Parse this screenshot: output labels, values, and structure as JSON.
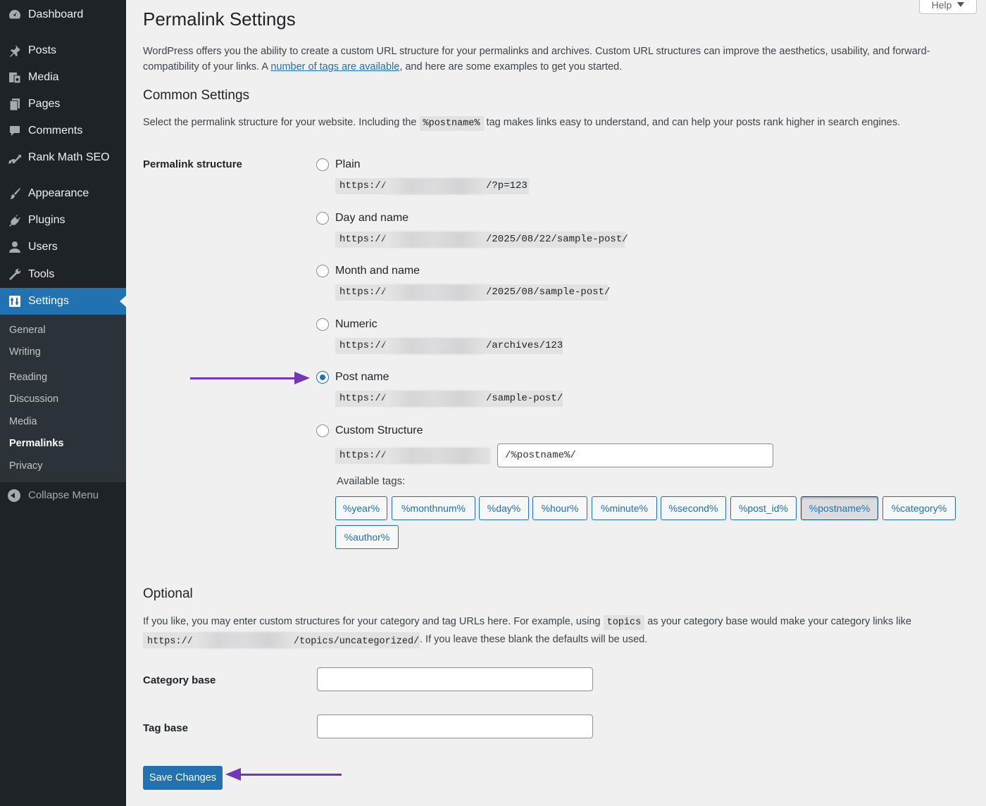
{
  "sidebar": {
    "menu": [
      {
        "label": "Dashboard",
        "icon": "dashboard-icon"
      },
      {
        "label": "Posts",
        "icon": "pin-icon"
      },
      {
        "label": "Media",
        "icon": "media-icon"
      },
      {
        "label": "Pages",
        "icon": "pages-icon"
      },
      {
        "label": "Comments",
        "icon": "comment-icon"
      },
      {
        "label": "Rank Math SEO",
        "icon": "rank-math-icon"
      },
      {
        "label": "Appearance",
        "icon": "brush-icon"
      },
      {
        "label": "Plugins",
        "icon": "plugin-icon"
      },
      {
        "label": "Users",
        "icon": "user-icon"
      },
      {
        "label": "Tools",
        "icon": "wrench-icon"
      },
      {
        "label": "Settings",
        "icon": "settings-icon"
      }
    ],
    "submenu": [
      "General",
      "Writing",
      "Reading",
      "Discussion",
      "Media",
      "Permalinks",
      "Privacy"
    ],
    "collapse_label": "Collapse Menu"
  },
  "header": {
    "help_label": "Help",
    "title": "Permalink Settings",
    "intro_before_link": "WordPress offers you the ability to create a custom URL structure for your permalinks and archives. Custom URL structures can improve the aesthetics, usability, and forward-compatibility of your links. A ",
    "intro_link": "number of tags are available",
    "intro_after_link": ", and here are some examples to get you started."
  },
  "common": {
    "heading": "Common Settings",
    "desc_before": "Select the permalink structure for your website. Including the ",
    "desc_code": "%postname%",
    "desc_after": " tag makes links easy to understand, and can help your posts rank higher in search engines.",
    "structure_label": "Permalink structure",
    "url_prefix": "https://",
    "options": [
      {
        "label": "Plain",
        "suffix": "/?p=123",
        "checked": false
      },
      {
        "label": "Day and name",
        "suffix": "/2025/08/22/sample-post/",
        "checked": false
      },
      {
        "label": "Month and name",
        "suffix": "/2025/08/sample-post/",
        "checked": false
      },
      {
        "label": "Numeric",
        "suffix": "/archives/123",
        "checked": false
      },
      {
        "label": "Post name",
        "suffix": "/sample-post/",
        "checked": true
      },
      {
        "label": "Custom Structure",
        "suffix": "",
        "checked": false
      }
    ],
    "custom_value": "/%postname%/",
    "available_tags_label": "Available tags:",
    "tags": [
      "%year%",
      "%monthnum%",
      "%day%",
      "%hour%",
      "%minute%",
      "%second%",
      "%post_id%",
      "%postname%",
      "%category%",
      "%author%"
    ],
    "active_tag": "%postname%"
  },
  "optional": {
    "heading": "Optional",
    "desc_before": "If you like, you may enter custom structures for your category and tag URLs here. For example, using ",
    "desc_code": "topics",
    "desc_middle": " as your category base would make your category links like",
    "example_prefix": "https://",
    "example_suffix": "/topics/uncategorized/",
    "desc_after": ". If you leave these blank the defaults will be used.",
    "category_base_label": "Category base",
    "category_base_value": "",
    "tag_base_label": "Tag base",
    "tag_base_value": ""
  },
  "save_label": "Save Changes",
  "colors": {
    "sidebar_bg": "#1d2327",
    "accent": "#2271b1",
    "annotation_arrow": "#7237b3"
  }
}
